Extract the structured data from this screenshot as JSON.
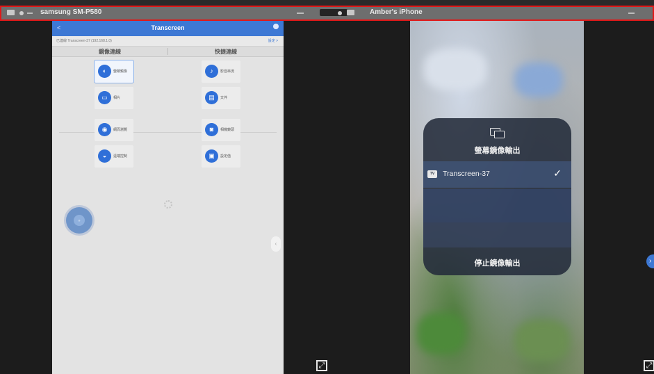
{
  "window": {
    "left_title": "samsung SM-P580",
    "right_title": "Amber's iPhone"
  },
  "android_app": {
    "title": "Transcreen",
    "back_label": "< ",
    "device_line": "已連線 Transcreen-37 (192.168.1.0)",
    "more_label": "設定 >",
    "tabs": [
      "鏡像連線",
      "快捷連線"
    ],
    "tiles": [
      {
        "label": "螢幕鏡像",
        "icon": "mirror-icon",
        "glyph": "◐"
      },
      {
        "label": "影音串流",
        "icon": "music-icon",
        "glyph": "♪"
      },
      {
        "label": "相片",
        "icon": "photo-icon",
        "glyph": "▭"
      },
      {
        "label": "文件",
        "icon": "document-icon",
        "glyph": "▤"
      },
      {
        "label": "網頁瀏覽",
        "icon": "web-icon",
        "glyph": "◉"
      },
      {
        "label": "相機鏡頭",
        "icon": "camera-icon",
        "glyph": "◙"
      },
      {
        "label": "遠端控制",
        "icon": "remote-icon",
        "glyph": "◒"
      },
      {
        "label": "設定值",
        "icon": "settings-icon",
        "glyph": "▣"
      }
    ]
  },
  "iphone": {
    "heading": "螢幕鏡像輸出",
    "device_name": "Transcreen-37",
    "tv_badge": "TV",
    "check": "✓",
    "stop_label": "停止鏡像輸出"
  },
  "colors": {
    "accent": "#3d78d4",
    "highlight_border": "#e01818"
  }
}
